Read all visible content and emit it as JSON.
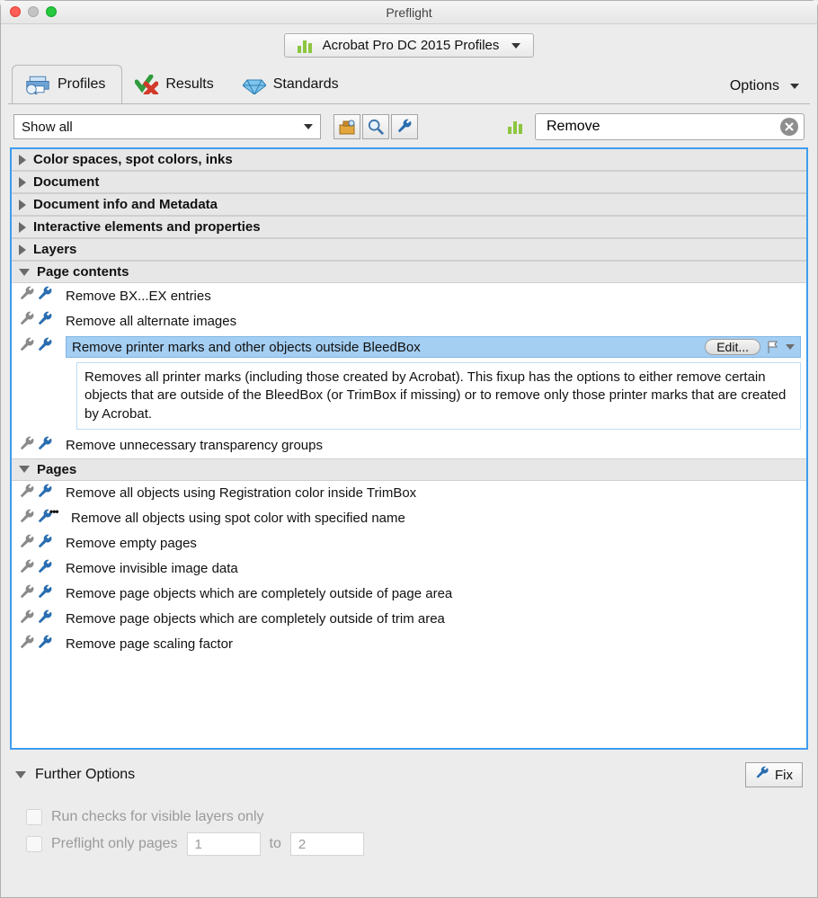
{
  "window": {
    "title": "Preflight"
  },
  "profileSelector": {
    "label": "Acrobat Pro DC 2015 Profiles"
  },
  "tabs": {
    "profiles": "Profiles",
    "results": "Results",
    "standards": "Standards",
    "options": "Options"
  },
  "toolbar": {
    "showAll": "Show all",
    "searchValue": "Remove"
  },
  "categories": [
    {
      "key": "colorspaces",
      "label": "Color spaces, spot colors, inks",
      "open": false
    },
    {
      "key": "document",
      "label": "Document",
      "open": false
    },
    {
      "key": "docinfo",
      "label": "Document info and Metadata",
      "open": false
    },
    {
      "key": "interactive",
      "label": "Interactive elements and properties",
      "open": false
    },
    {
      "key": "layers",
      "label": "Layers",
      "open": false
    },
    {
      "key": "pagecontents",
      "label": "Page contents",
      "open": true
    },
    {
      "key": "pages",
      "label": "Pages",
      "open": true
    }
  ],
  "pageContentsItems": [
    {
      "label": "Remove BX...EX entries"
    },
    {
      "label": "Remove all alternate images"
    },
    {
      "label": "Remove printer marks and other objects outside BleedBox",
      "selected": true,
      "editLabel": "Edit...",
      "description": "Removes all printer marks (including those created by Acrobat). This fixup has the options to either remove certain objects that are outside of the BleedBox (or TrimBox if missing) or to remove only those printer marks that are created by Acrobat."
    },
    {
      "label": "Remove unnecessary transparency groups"
    }
  ],
  "pagesItems": [
    {
      "label": "Remove all objects using Registration color inside TrimBox"
    },
    {
      "label": "Remove all objects using spot color with specified name",
      "hasDotsBadge": true
    },
    {
      "label": "Remove empty pages"
    },
    {
      "label": "Remove invisible image data"
    },
    {
      "label": "Remove page objects which are completely outside of page area"
    },
    {
      "label": "Remove page objects which are completely outside of trim area"
    },
    {
      "label": "Remove page scaling factor"
    }
  ],
  "further": {
    "label": "Further Options",
    "fix": "Fix",
    "opt1": "Run checks for visible layers only",
    "opt2": "Preflight only pages",
    "to": "to",
    "from": "1",
    "toVal": "2"
  }
}
